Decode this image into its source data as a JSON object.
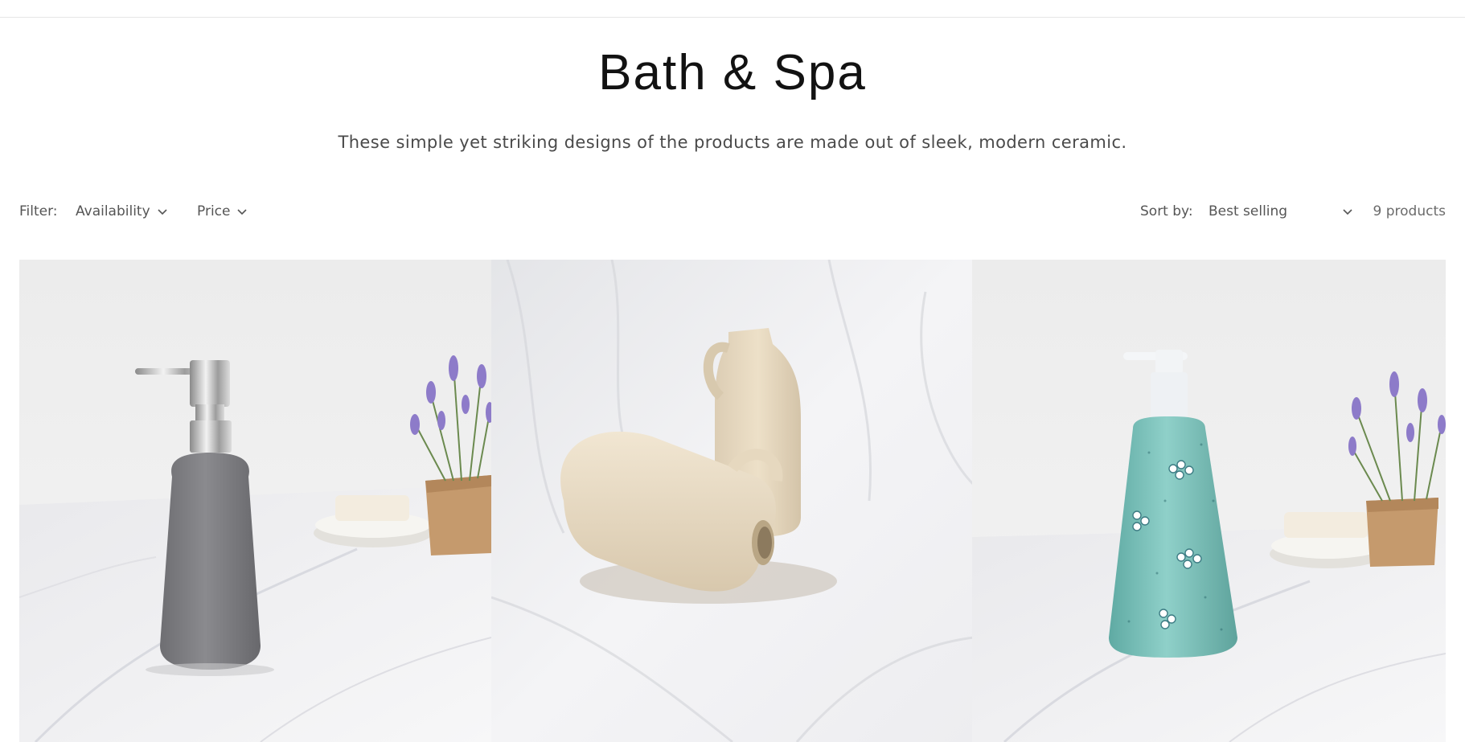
{
  "collection": {
    "title": "Bath & Spa",
    "description": "These simple yet striking designs of the products are made out of sleek, modern ceramic."
  },
  "toolbar": {
    "filter_label": "Filter:",
    "filters": [
      "Availability",
      "Price"
    ],
    "sort_label": "Sort by:",
    "sort_value": "Best selling",
    "product_count": "9 products"
  },
  "products": [
    {
      "image": "grey ceramic soap dispenser with chrome pump on marble counter with lavender and soap dish",
      "color": "#7d7d80"
    },
    {
      "image": "two cream ceramic jugs on white draped fabric",
      "color": "#e9dcc6"
    },
    {
      "image": "turquoise speckled ceramic soap dispenser with flower pattern and white pump",
      "color": "#7cc1bb"
    }
  ],
  "icons": {
    "chevron": "chevron-down-icon"
  }
}
